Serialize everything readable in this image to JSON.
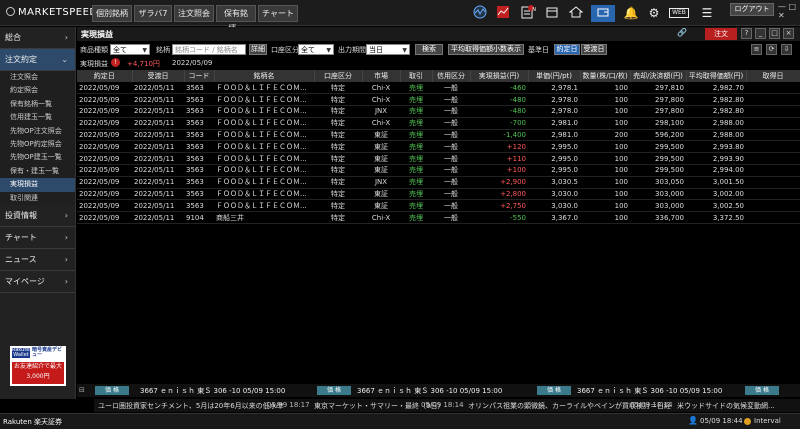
{
  "app": {
    "title": "MARKETSPEEDⅡ",
    "logout": "ログアウト"
  },
  "tabs": [
    "個別銘柄",
    "ザラバ7",
    "注文照会",
    "保有銘柄...",
    "チャート"
  ],
  "top_icons": [
    "tick-chart-icon",
    "graph-icon",
    "news-icon",
    "calendar-icon",
    "home-icon",
    "share-icon",
    "wallet-icon",
    "bell-icon",
    "settings-icon",
    "web-icon",
    "menu-icon"
  ],
  "top_icon_labels": {
    "news_badge": "N",
    "web": "WEB"
  },
  "sidebar": {
    "sections": [
      {
        "label": "総合",
        "open": false
      },
      {
        "label": "注文約定",
        "open": true
      }
    ],
    "sub_items": [
      "注文照会",
      "約定照会",
      "保有銘柄一覧",
      "信用建玉一覧",
      "先物OP注文照会",
      "先物OP約定照会",
      "先物OP建玉一覧",
      "保有・建玉一覧",
      "実現損益",
      "取引関連"
    ],
    "active_sub": "実現損益",
    "bottom_sections": [
      "投資情報",
      "チャート",
      "ニュース",
      "マイページ"
    ],
    "banner": {
      "line1": "Rakuten Wallet",
      "line2": "暗号資産デビュー",
      "line3": "お友達紹介で最大3,000円"
    }
  },
  "panel": {
    "title": "実現損益",
    "order_button": "注文",
    "filters": {
      "product_label": "商品種類",
      "product_value": "全て",
      "issue_label": "銘柄",
      "issue_placeholder": "銘柄コード / 銘柄名",
      "detail_button": "詳細",
      "account_label": "口座区分",
      "account_value": "全て",
      "period_label": "出力期間",
      "period_value": "当日",
      "search_button": "検索",
      "avg_button": "平均取得価額小数表示",
      "base_label": "基準日",
      "exec_date_button": "約定日",
      "delivery_date_button": "受渡日"
    },
    "summary": {
      "label": "実現損益",
      "value": "+4,710円",
      "date": "2022/05/09"
    }
  },
  "table": {
    "columns": [
      "約定日",
      "受渡日",
      "コード",
      "銘柄名",
      "口座区分",
      "市場",
      "取引",
      "信用区分",
      "実現損益(円)",
      "単価(円/pt)",
      "数量(株/口/枚)",
      "売却/決済額(円)",
      "平均取得価額(円)",
      "取得日"
    ],
    "rows": [
      [
        "2022/05/09",
        "2022/05/11",
        "3563",
        "ＦＯＯＤ＆ＬＩＦＥＣＯＭ...",
        "特定",
        "Chi-X",
        "売埋",
        "一般",
        "-460",
        "2,978.1",
        "100",
        "297,810",
        "2,982.70",
        ""
      ],
      [
        "2022/05/09",
        "2022/05/11",
        "3563",
        "ＦＯＯＤ＆ＬＩＦＥＣＯＭ...",
        "特定",
        "Chi-X",
        "売埋",
        "一般",
        "-480",
        "2,978.0",
        "100",
        "297,800",
        "2,982.80",
        ""
      ],
      [
        "2022/05/09",
        "2022/05/11",
        "3563",
        "ＦＯＯＤ＆ＬＩＦＥＣＯＭ...",
        "特定",
        "JNX",
        "売埋",
        "一般",
        "-480",
        "2,978.0",
        "100",
        "297,800",
        "2,982.80",
        ""
      ],
      [
        "2022/05/09",
        "2022/05/11",
        "3563",
        "ＦＯＯＤ＆ＬＩＦＥＣＯＭ...",
        "特定",
        "Chi-X",
        "売埋",
        "一般",
        "-700",
        "2,981.0",
        "100",
        "298,100",
        "2,988.00",
        ""
      ],
      [
        "2022/05/09",
        "2022/05/11",
        "3563",
        "ＦＯＯＤ＆ＬＩＦＥＣＯＭ...",
        "特定",
        "東証",
        "売埋",
        "一般",
        "-1,400",
        "2,981.0",
        "200",
        "596,200",
        "2,988.00",
        ""
      ],
      [
        "2022/05/09",
        "2022/05/11",
        "3563",
        "ＦＯＯＤ＆ＬＩＦＥＣＯＭ...",
        "特定",
        "東証",
        "売埋",
        "一般",
        "+120",
        "2,995.0",
        "100",
        "299,500",
        "2,993.80",
        ""
      ],
      [
        "2022/05/09",
        "2022/05/11",
        "3563",
        "ＦＯＯＤ＆ＬＩＦＥＣＯＭ...",
        "特定",
        "東証",
        "売埋",
        "一般",
        "+110",
        "2,995.0",
        "100",
        "299,500",
        "2,993.90",
        ""
      ],
      [
        "2022/05/09",
        "2022/05/11",
        "3563",
        "ＦＯＯＤ＆ＬＩＦＥＣＯＭ...",
        "特定",
        "東証",
        "売埋",
        "一般",
        "+100",
        "2,995.0",
        "100",
        "299,500",
        "2,994.00",
        ""
      ],
      [
        "2022/05/09",
        "2022/05/11",
        "3563",
        "ＦＯＯＤ＆ＬＩＦＥＣＯＭ...",
        "特定",
        "JNX",
        "売埋",
        "一般",
        "+2,900",
        "3,030.5",
        "100",
        "303,050",
        "3,001.50",
        ""
      ],
      [
        "2022/05/09",
        "2022/05/11",
        "3563",
        "ＦＯＯＤ＆ＬＩＦＥＣＯＭ...",
        "特定",
        "東証",
        "売埋",
        "一般",
        "+2,800",
        "3,030.0",
        "100",
        "303,000",
        "3,002.00",
        ""
      ],
      [
        "2022/05/09",
        "2022/05/11",
        "3563",
        "ＦＯＯＤ＆ＬＩＦＥＣＯＭ...",
        "特定",
        "東証",
        "売埋",
        "一般",
        "+2,750",
        "3,030.0",
        "100",
        "303,000",
        "3,002.50",
        ""
      ],
      [
        "2022/05/09",
        "2022/05/11",
        "9104",
        "商船三井",
        "特定",
        "Chi-X",
        "売埋",
        "一般",
        "-550",
        "3,367.0",
        "100",
        "336,700",
        "3,372.50",
        ""
      ]
    ]
  },
  "ticker": {
    "badge": "価 格",
    "item": "3667 ｅｎｉｓｈ 東Ｓ 306 -10 05/09 15:00",
    "news": [
      "ユーロ圏投資家センチメント、5月は20年6月以来の低水準",
      "05/09 18:17",
      "東京マーケット・サマリー・最終（9日）",
      "05/09 18:14",
      "オリンパス祖業の顕微鏡、カーライルやベインが買収検討＝日経",
      "05/09 18:14",
      "米ウッドサイドの気候変動網..."
    ]
  },
  "footer": {
    "brand": "Rakuten 楽天証券",
    "clock": "05/09 18:44",
    "interval": "Interval"
  },
  "colors": {
    "positive": "#ff5a5a",
    "negative": "#52c252",
    "sell": "#52c252",
    "accent": "#2866b0",
    "order": "#b82020"
  }
}
